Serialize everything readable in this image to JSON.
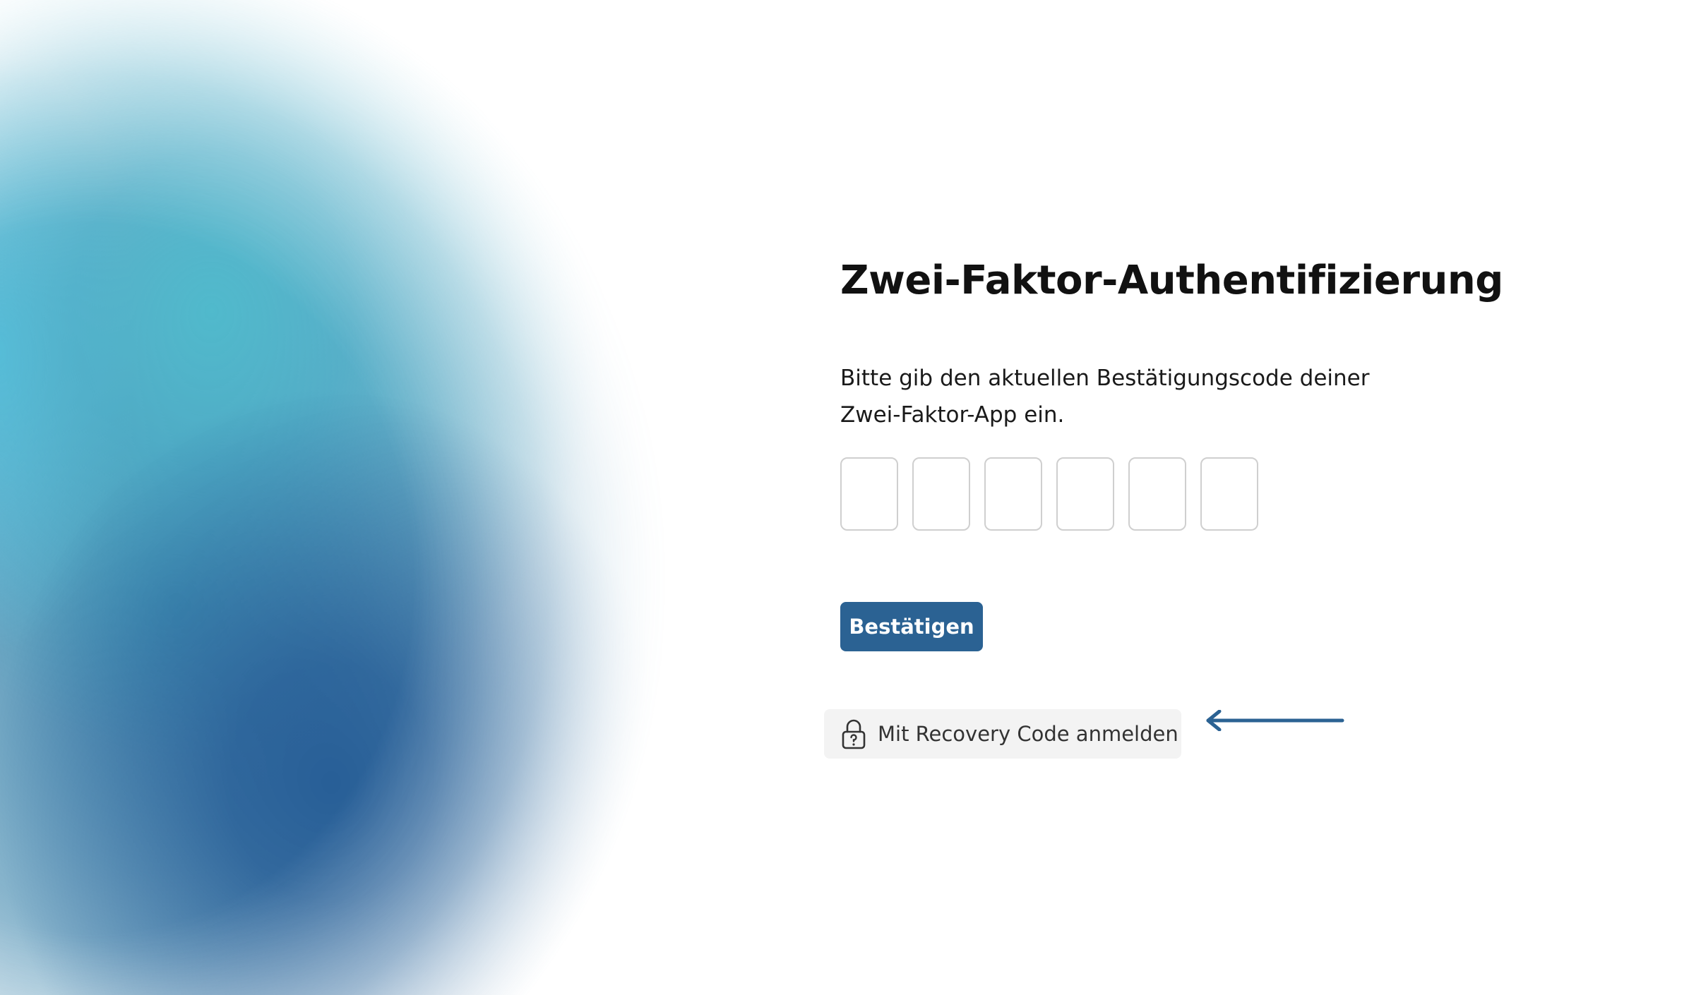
{
  "title": "Zwei-Faktor-Authentifizierung",
  "description": "Bitte gib den aktuellen Bestätigungscode deiner Zwei-Faktor-App ein.",
  "code_inputs": [
    "",
    "",
    "",
    "",
    "",
    ""
  ],
  "confirm_label": "Bestätigen",
  "recovery": {
    "label": "Mit Recovery Code anmelden",
    "icon": "lock-question-icon"
  },
  "arrow": {
    "icon": "arrow-left-icon",
    "color": "#2b6293"
  },
  "colors": {
    "primary": "#2b6293",
    "recovery_bg": "#f3f3f3",
    "input_border": "#cfcfcf"
  }
}
